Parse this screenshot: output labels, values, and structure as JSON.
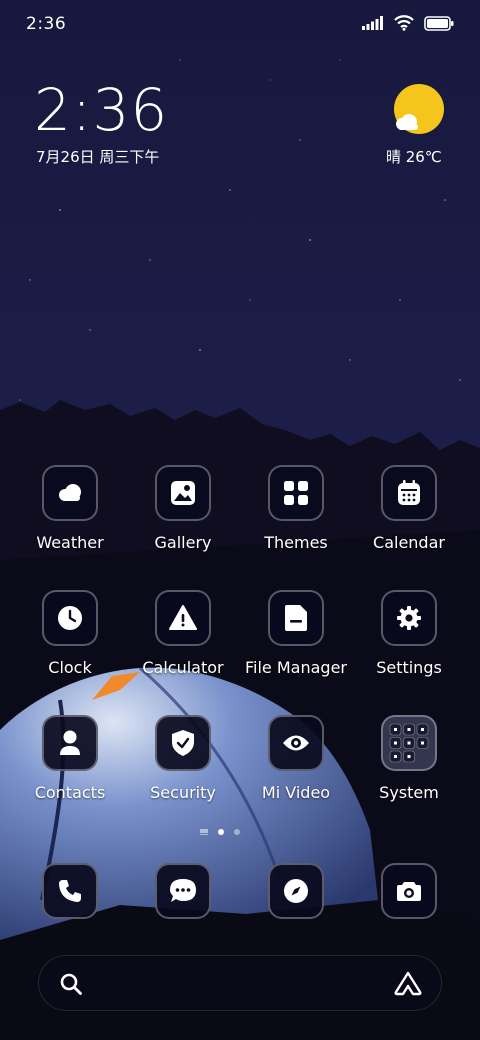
{
  "status_bar": {
    "time": "2:36"
  },
  "clock_widget": {
    "time": "2:36",
    "date": "7月26日 周三下午"
  },
  "weather_widget": {
    "condition_temp": "晴 26℃",
    "icon": "sunny-cloud-icon",
    "sun_color": "#F6C51B"
  },
  "apps": [
    {
      "label": "Weather",
      "icon": "weather-icon"
    },
    {
      "label": "Gallery",
      "icon": "gallery-icon"
    },
    {
      "label": "Themes",
      "icon": "themes-icon"
    },
    {
      "label": "Calendar",
      "icon": "calendar-icon"
    },
    {
      "label": "Clock",
      "icon": "clock-icon"
    },
    {
      "label": "Calculator",
      "icon": "calculator-icon"
    },
    {
      "label": "File Manager",
      "icon": "file-manager-icon"
    },
    {
      "label": "Settings",
      "icon": "settings-icon"
    },
    {
      "label": "Contacts",
      "icon": "contacts-icon"
    },
    {
      "label": "Security",
      "icon": "security-icon"
    },
    {
      "label": "Mi Video",
      "icon": "mi-video-icon"
    },
    {
      "label": "System",
      "icon": "system-folder-icon"
    }
  ],
  "dock": [
    {
      "icon": "phone-icon"
    },
    {
      "icon": "messages-icon"
    },
    {
      "icon": "browser-icon"
    },
    {
      "icon": "camera-icon"
    }
  ],
  "page_indicator": {
    "pages": 2,
    "active": 1
  },
  "search_bar": {
    "left_icon": "search-icon",
    "right_icon": "app-vault-icon"
  }
}
